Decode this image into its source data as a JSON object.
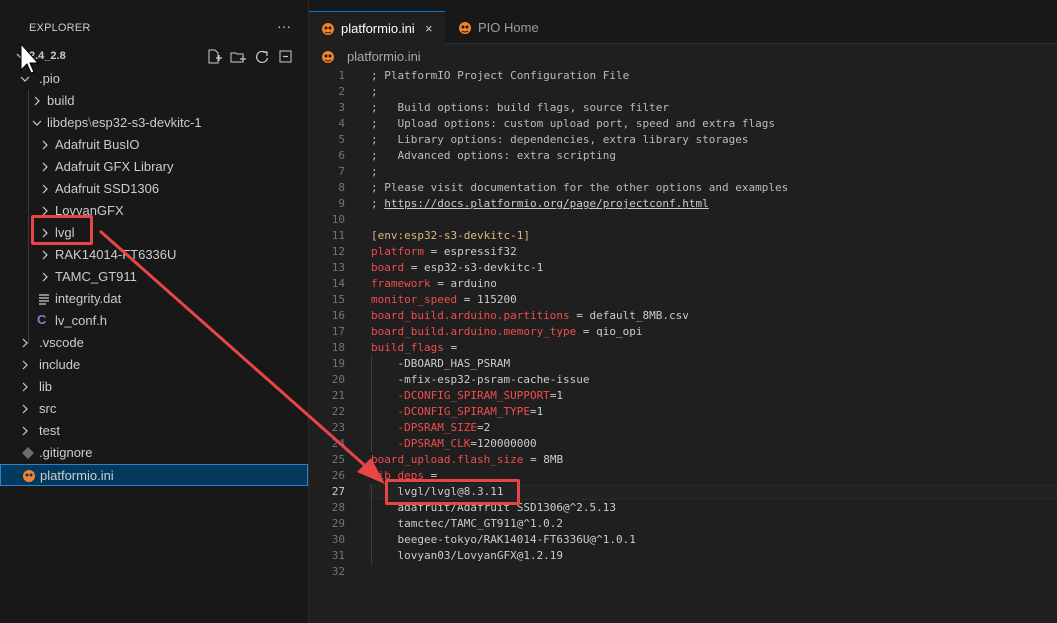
{
  "explorer": {
    "title": "EXPLORER",
    "more_label": "···",
    "project_name": "2.4_2.8",
    "tree": [
      {
        "label": ".pio",
        "kind": "folder",
        "expanded": true
      },
      {
        "label": "build",
        "kind": "folder",
        "expanded": false
      },
      {
        "label": "libdeps",
        "sep": "\\",
        "suffix": "esp32-s3-devkitc-1",
        "kind": "folder",
        "expanded": true
      },
      {
        "label": "Adafruit BusIO",
        "kind": "folder",
        "expanded": false
      },
      {
        "label": "Adafruit GFX Library",
        "kind": "folder",
        "expanded": false
      },
      {
        "label": "Adafruit SSD1306",
        "kind": "folder",
        "expanded": false
      },
      {
        "label": "LovyanGFX",
        "kind": "folder",
        "expanded": false
      },
      {
        "label": "lvgl",
        "kind": "folder",
        "expanded": false
      },
      {
        "label": "RAK14014-FT6336U",
        "kind": "folder",
        "expanded": false
      },
      {
        "label": "TAMC_GT911",
        "kind": "folder",
        "expanded": false
      },
      {
        "label": "integrity.dat",
        "kind": "file-lines"
      },
      {
        "label": "lv_conf.h",
        "kind": "file-c",
        "icon_text": "C"
      },
      {
        "label": ".vscode",
        "kind": "folder",
        "expanded": false
      },
      {
        "label": "include",
        "kind": "folder",
        "expanded": false
      },
      {
        "label": "lib",
        "kind": "folder",
        "expanded": false
      },
      {
        "label": "src",
        "kind": "folder",
        "expanded": false
      },
      {
        "label": "test",
        "kind": "folder",
        "expanded": false
      },
      {
        "label": ".gitignore",
        "kind": "file-git"
      },
      {
        "label": "platformio.ini",
        "kind": "file-pio",
        "selected": true
      }
    ]
  },
  "tabs": [
    {
      "label": "platformio.ini",
      "active": true,
      "close": "×"
    },
    {
      "label": "PIO Home",
      "active": false
    }
  ],
  "breadcrumb": {
    "file": "platformio.ini"
  },
  "editor": {
    "current_line": 27,
    "lines": [
      {
        "n": "1",
        "parts": [
          {
            "t": "; PlatformIO Project Configuration File",
            "c": "comment"
          }
        ]
      },
      {
        "n": "2",
        "parts": [
          {
            "t": ";",
            "c": "comment"
          }
        ]
      },
      {
        "n": "3",
        "parts": [
          {
            "t": ";   Build options: build flags, source filter",
            "c": "comment"
          }
        ]
      },
      {
        "n": "4",
        "parts": [
          {
            "t": ";   Upload options: custom upload port, speed and extra flags",
            "c": "comment"
          }
        ]
      },
      {
        "n": "5",
        "parts": [
          {
            "t": ";   Library options: dependencies, extra library storages",
            "c": "comment"
          }
        ]
      },
      {
        "n": "6",
        "parts": [
          {
            "t": ";   Advanced options: extra scripting",
            "c": "comment"
          }
        ]
      },
      {
        "n": "7",
        "parts": [
          {
            "t": ";",
            "c": "comment"
          }
        ]
      },
      {
        "n": "8",
        "parts": [
          {
            "t": "; Please visit documentation for the other options and examples",
            "c": "comment"
          }
        ]
      },
      {
        "n": "9",
        "parts": [
          {
            "t": "; ",
            "c": "comment"
          },
          {
            "t": "https://docs.platformio.org/page/projectconf.html",
            "c": "link"
          }
        ]
      },
      {
        "n": "10",
        "parts": []
      },
      {
        "n": "11",
        "parts": [
          {
            "t": "[env:esp32-s3-devkitc-1]",
            "c": "section"
          }
        ]
      },
      {
        "n": "12",
        "parts": [
          {
            "t": "platform",
            "c": "key"
          },
          {
            "t": " = espressif32",
            "c": "val"
          }
        ]
      },
      {
        "n": "13",
        "parts": [
          {
            "t": "board",
            "c": "key"
          },
          {
            "t": " = esp32-s3-devkitc-1",
            "c": "val"
          }
        ]
      },
      {
        "n": "14",
        "parts": [
          {
            "t": "framework",
            "c": "key"
          },
          {
            "t": " = arduino",
            "c": "val"
          }
        ]
      },
      {
        "n": "15",
        "parts": [
          {
            "t": "monitor_speed",
            "c": "key"
          },
          {
            "t": " = 115200",
            "c": "val"
          }
        ]
      },
      {
        "n": "16",
        "parts": [
          {
            "t": "board_build.arduino.partitions",
            "c": "key"
          },
          {
            "t": " = default_8MB.csv",
            "c": "val"
          }
        ]
      },
      {
        "n": "17",
        "parts": [
          {
            "t": "board_build.arduino.memory_type",
            "c": "key"
          },
          {
            "t": " = qio_opi",
            "c": "val"
          }
        ]
      },
      {
        "n": "18",
        "parts": [
          {
            "t": "build_flags",
            "c": "key"
          },
          {
            "t": " =",
            "c": "val"
          }
        ]
      },
      {
        "n": "19",
        "parts": [
          {
            "t": "    -DBOARD_HAS_PSRAM",
            "c": "val"
          }
        ]
      },
      {
        "n": "20",
        "parts": [
          {
            "t": "    -mfix-esp32-psram-cache-issue",
            "c": "val"
          }
        ]
      },
      {
        "n": "21",
        "parts": [
          {
            "t": "    -DCONFIG_SPIRAM_SUPPORT",
            "c": "key"
          },
          {
            "t": "=1",
            "c": "val"
          }
        ]
      },
      {
        "n": "22",
        "parts": [
          {
            "t": "    -DCONFIG_SPIRAM_TYPE",
            "c": "key"
          },
          {
            "t": "=1",
            "c": "val"
          }
        ]
      },
      {
        "n": "23",
        "parts": [
          {
            "t": "    -DPSRAM_SIZE",
            "c": "key"
          },
          {
            "t": "=2",
            "c": "val"
          }
        ]
      },
      {
        "n": "24",
        "parts": [
          {
            "t": "    -DPSRAM_CLK",
            "c": "key"
          },
          {
            "t": "=120000000",
            "c": "val"
          }
        ]
      },
      {
        "n": "25",
        "parts": [
          {
            "t": "board_upload.flash_size",
            "c": "key"
          },
          {
            "t": " = 8MB",
            "c": "val"
          }
        ]
      },
      {
        "n": "26",
        "parts": [
          {
            "t": "lib_deps",
            "c": "key"
          },
          {
            "t": " =",
            "c": "val"
          }
        ]
      },
      {
        "n": "27",
        "parts": [
          {
            "t": "    lvgl/lvgl@8.3.11",
            "c": "val"
          }
        ]
      },
      {
        "n": "28",
        "parts": [
          {
            "t": "    adafruit/Adafruit SSD1306@^2.5.13",
            "c": "val"
          }
        ]
      },
      {
        "n": "29",
        "parts": [
          {
            "t": "    tamctec/TAMC_GT911@^1.0.2",
            "c": "val"
          }
        ]
      },
      {
        "n": "30",
        "parts": [
          {
            "t": "    beegee-tokyo/RAK14014-FT6336U@^1.0.1",
            "c": "val"
          }
        ]
      },
      {
        "n": "31",
        "parts": [
          {
            "t": "    lovyan03/LovyanGFX@1.2.19",
            "c": "val"
          }
        ]
      },
      {
        "n": "32",
        "parts": []
      }
    ]
  },
  "colors": {
    "annotation": "#e84646",
    "selection": "#04395e",
    "pio_orange": "#f5822a"
  },
  "icons": {
    "more": "ellipsis-icon",
    "new_file": "new-file-icon",
    "new_folder": "new-folder-icon",
    "refresh": "refresh-icon",
    "collapse": "collapse-all-icon",
    "pio": "platformio-alien-icon",
    "cursor": "mouse-pointer-icon",
    "annotation_arrow": "red-arrow-icon"
  }
}
